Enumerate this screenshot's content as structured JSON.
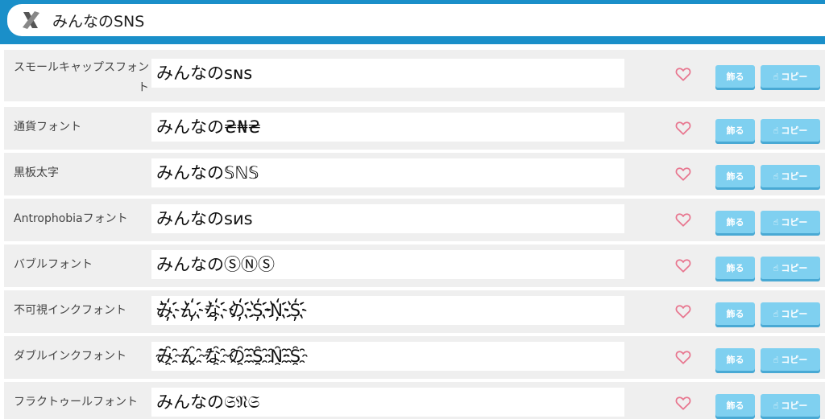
{
  "search": {
    "query": "みんなのSNS"
  },
  "icons": {
    "clear": "close-x-icon",
    "favorite": "heart-icon",
    "copy": "hand-pointer-icon"
  },
  "colors": {
    "header": "#1a8fc9",
    "button": "#7fd0f0",
    "heart": "#e8768f"
  },
  "fonts": [
    {
      "label": "スモールキャップスフォント",
      "preview": "みんなのꜱɴꜱ",
      "decorate": "飾る",
      "copy": "コピー"
    },
    {
      "label": "通貨フォント",
      "preview": "みんなの₴₦₴",
      "decorate": "飾る",
      "copy": "コピー"
    },
    {
      "label": "黒板太字",
      "preview": "みんなの𝕊ℕ𝕊",
      "decorate": "飾る",
      "copy": "コピー"
    },
    {
      "label": "Antrophobiaフォント",
      "preview": "みんなのsиs",
      "decorate": "飾る",
      "copy": "コピー"
    },
    {
      "label": "バブルフォント",
      "preview": "みんなのⓈⓃⓈ",
      "decorate": "飾る",
      "copy": "コピー"
    },
    {
      "label": "不可視インクフォント",
      "preview": "み҉ん҉な҉の҉S҉N҉S҉",
      "decorate": "飾る",
      "copy": "コピー"
    },
    {
      "label": "ダブルインクフォント",
      "preview": "み҈ん҈な҈の҈S҈N҈S҈",
      "decorate": "飾る",
      "copy": "コピー"
    },
    {
      "label": "フラクトゥールフォント",
      "preview": "みんなの𝔖𝔑𝔖",
      "decorate": "飾る",
      "copy": "コピー"
    }
  ]
}
